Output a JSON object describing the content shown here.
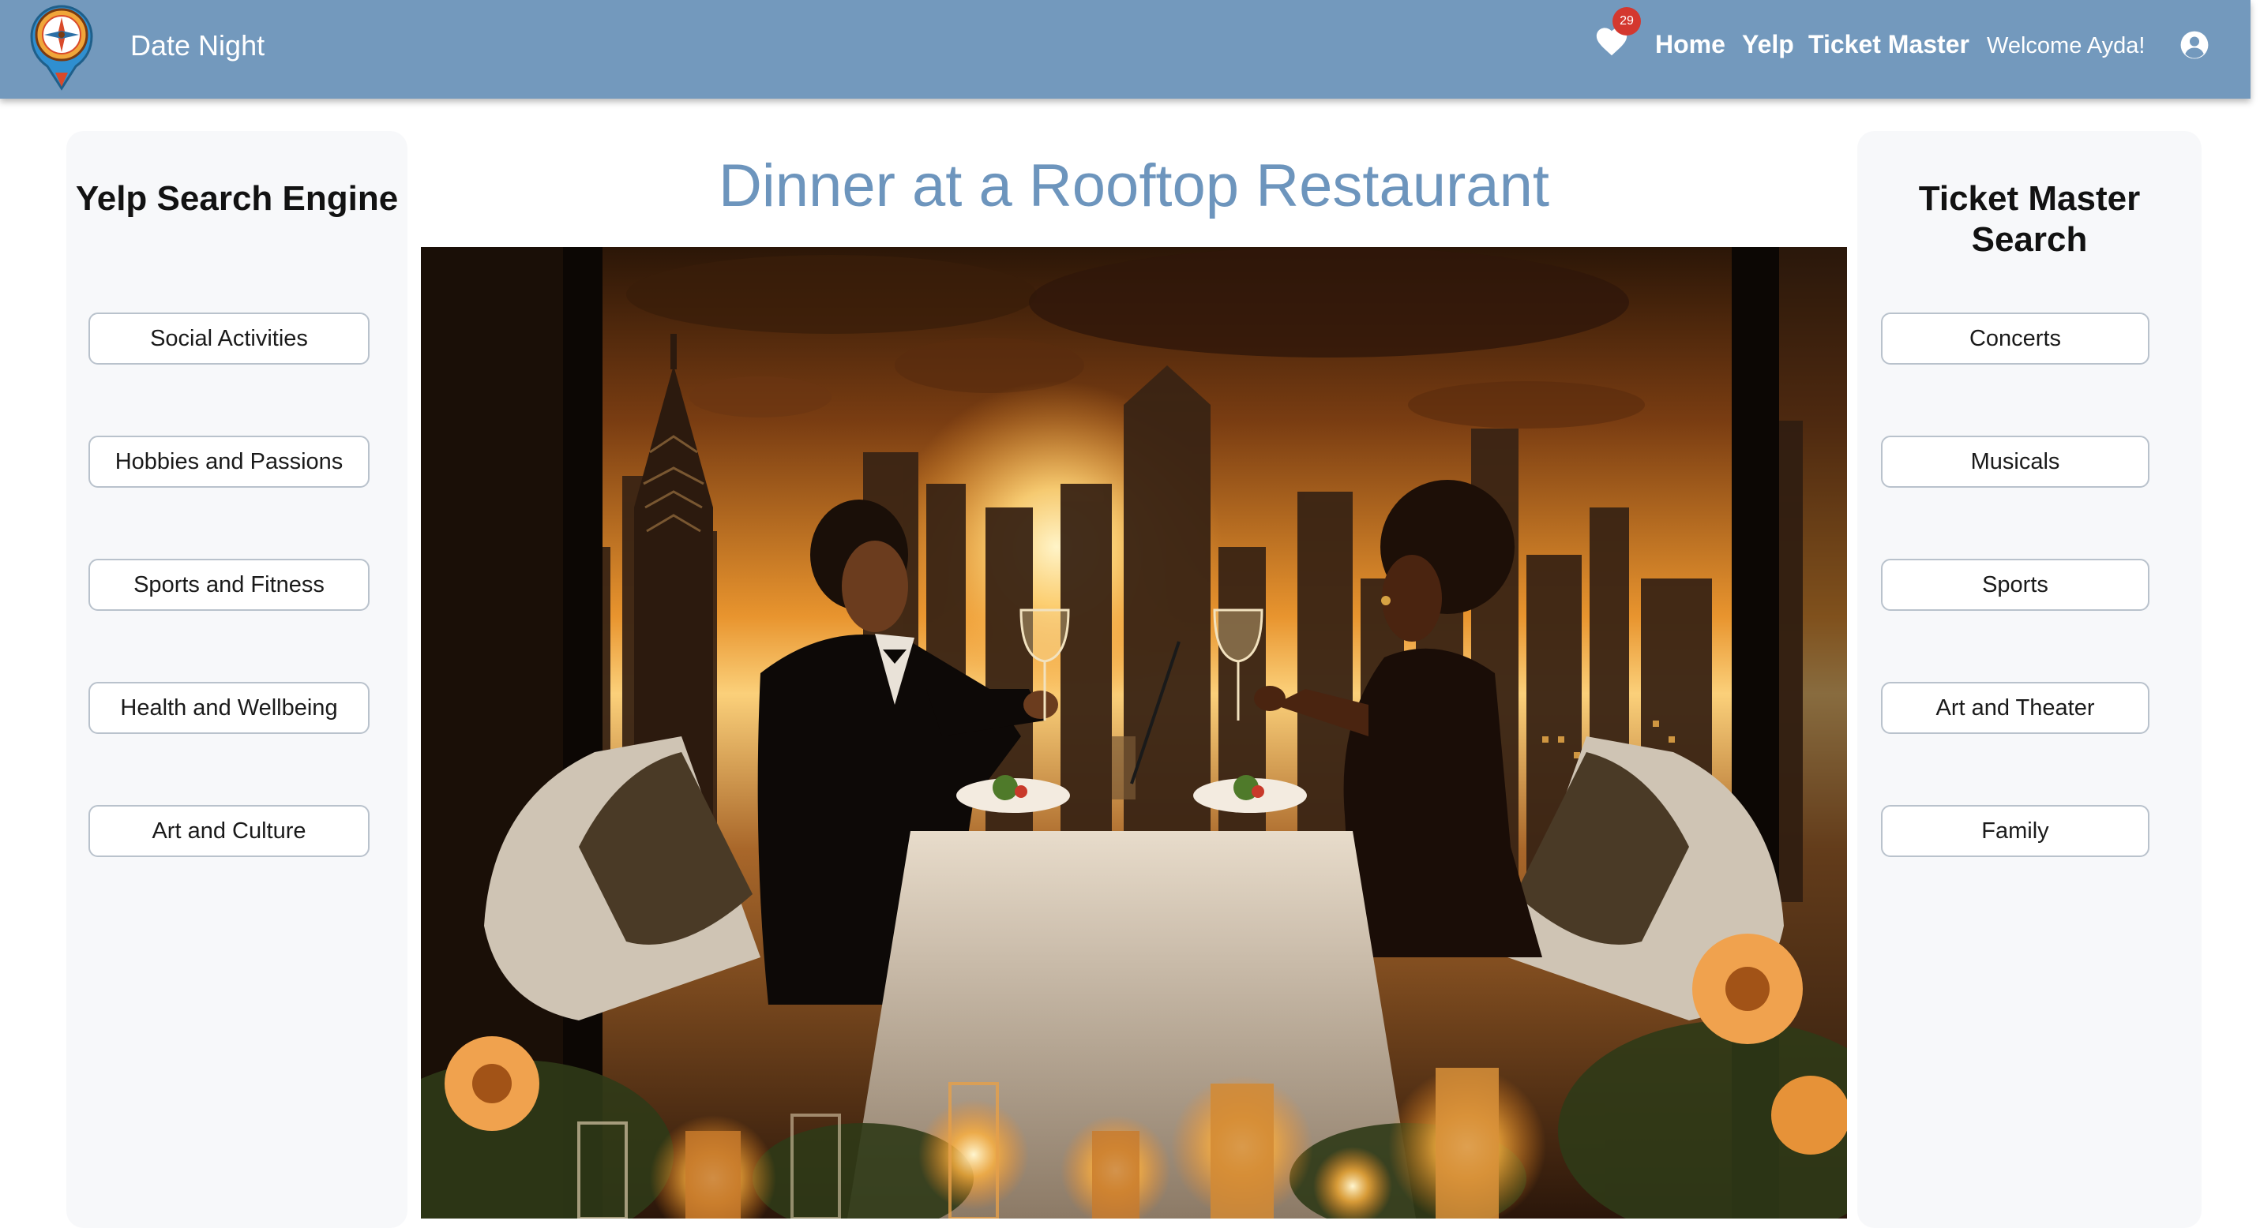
{
  "app": {
    "title": "Date Night",
    "logo_icon": "compass-map-pin-logo"
  },
  "navbar": {
    "background": "#7399bd",
    "favorites_count": "29",
    "favorites_icon": "heart-icon",
    "links": [
      "Home",
      "Yelp",
      "Ticket Master"
    ],
    "welcome_text": "Welcome Ayda!",
    "user_icon": "user-circle-icon"
  },
  "left_panel": {
    "title": "Yelp Search Engine",
    "buttons": [
      "Social Activities",
      "Hobbies and Passions",
      "Sports and Fitness",
      "Health and Wellbeing",
      "Art and Culture"
    ]
  },
  "main": {
    "title": "Dinner at a Rooftop Restaurant",
    "title_color": "#6d95bd",
    "image_description": "couple toasting at a rooftop dinner table at sunset above a city skyline"
  },
  "right_panel": {
    "title": "Ticket Master Search",
    "buttons": [
      "Concerts",
      "Musicals",
      "Sports",
      "Art and Theater",
      "Family"
    ]
  }
}
